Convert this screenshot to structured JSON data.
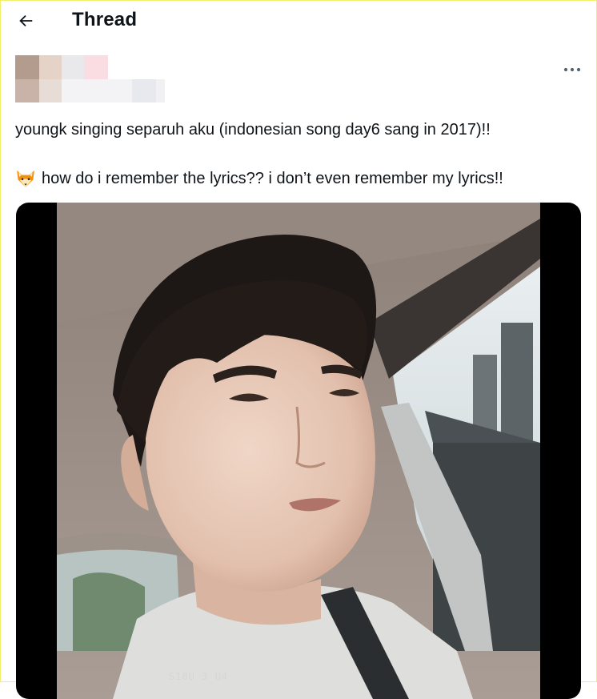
{
  "header": {
    "title": "Thread",
    "back_icon": "arrow-left-icon"
  },
  "post": {
    "author_redacted": true,
    "more_icon": "more-horizontal-icon",
    "text_line1": "youngk singing separuh aku (indonesian song day6 sang in 2017)!!",
    "text_line2_emoji": "fox-face-icon",
    "text_line2": "how do i remember the lyrics?? i don’t even remember my lyrics!!",
    "media": {
      "type": "video",
      "overlay_text": "S10U 3 U4"
    }
  },
  "colors": {
    "text": "#0f1419",
    "media_background": "#000000",
    "frame": "#f2ee6a"
  }
}
